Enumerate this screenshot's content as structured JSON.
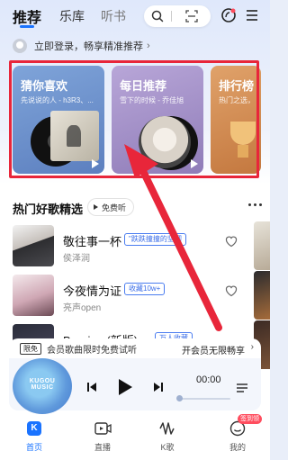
{
  "top_nav": {
    "tabs": [
      "推荐",
      "乐库",
      "听书"
    ],
    "active_tab": 0,
    "icons": [
      "search-icon",
      "scan-icon",
      "listen-recognize-icon",
      "menu-icon"
    ]
  },
  "login_prompt": {
    "text": "立即登录，畅享精准推荐",
    "chevron": "›"
  },
  "recommend_cards": [
    {
      "title": "猜你喜欢",
      "subtitle": "先说说的人 - h3R3、..."
    },
    {
      "title": "每日推荐",
      "subtitle": "雪下的时候 - 乔佳旭"
    },
    {
      "title": "排行榜",
      "subtitle": "热门之选，"
    }
  ],
  "hot_songs": {
    "title": "热门好歌精选",
    "free_label": "免费听",
    "items": [
      {
        "name": "敬往事一杯",
        "tag": "\"跌跌撞撞的坚韧",
        "artist": "侯泽润"
      },
      {
        "name": "今夜情为证",
        "tag": "收藏10w+",
        "artist": "亮声open"
      },
      {
        "name": "Burning (新版)",
        "tag": "万人收藏",
        "artist": ""
      }
    ]
  },
  "vip_bar": {
    "badge": "限免",
    "text": "会员歌曲限时免费试听",
    "cta": "开会员无限畅享",
    "chevron": "›"
  },
  "player": {
    "art_text": "KUGOU MUSIC",
    "time": "00:00",
    "progress": 0
  },
  "bottom_nav": [
    {
      "label": "首页",
      "icon": "home-icon"
    },
    {
      "label": "直播",
      "icon": "live-icon"
    },
    {
      "label": "K歌",
      "icon": "karaoke-icon"
    },
    {
      "label": "我的",
      "icon": "profile-icon",
      "badge": "签到领"
    }
  ],
  "colors": {
    "accent": "#1a73ff",
    "annotation_red": "#e8263a"
  }
}
